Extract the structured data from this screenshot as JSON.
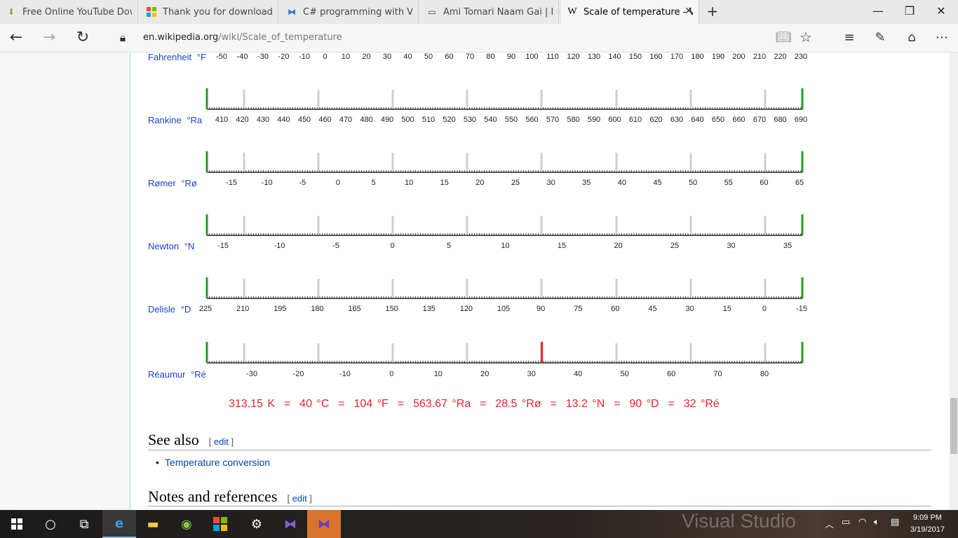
{
  "browser": {
    "tabs": [
      {
        "title": "Free Online YouTube Down",
        "icon": "download-icon",
        "active": false
      },
      {
        "title": "Thank you for downloading",
        "icon": "windows-logo-icon",
        "active": false
      },
      {
        "title": "C# programming with Visu",
        "icon": "visual-studio-icon",
        "active": false
      },
      {
        "title": "Ami Tomari Naam Gai | Bhul",
        "icon": "page-icon",
        "active": false
      },
      {
        "title": "Scale of temperature - V",
        "icon": "wikipedia-icon",
        "active": true
      }
    ],
    "url_host": "en.wikipedia.org",
    "url_path": "/wiki/Scale_of_temperature"
  },
  "scales": [
    {
      "name": "Fahrenheit",
      "unit": "°F",
      "ticks": [
        "-50",
        "-40",
        "-30",
        "-20",
        "-10",
        "0",
        "10",
        "20",
        "30",
        "40",
        "50",
        "60",
        "70",
        "80",
        "90",
        "100",
        "110",
        "120",
        "130",
        "140",
        "150",
        "160",
        "170",
        "180",
        "190",
        "200",
        "210",
        "220",
        "230"
      ]
    },
    {
      "name": "Rankine",
      "unit": "°Ra",
      "ticks": [
        "410",
        "420",
        "430",
        "440",
        "450",
        "460",
        "470",
        "480",
        "490",
        "500",
        "510",
        "520",
        "530",
        "540",
        "550",
        "560",
        "570",
        "580",
        "590",
        "600",
        "610",
        "620",
        "630",
        "640",
        "650",
        "660",
        "670",
        "680",
        "690"
      ]
    },
    {
      "name": "Rømer",
      "unit": "°Rø",
      "ticks": [
        "-15",
        "-10",
        "-5",
        "0",
        "5",
        "10",
        "15",
        "20",
        "25",
        "30",
        "35",
        "40",
        "45",
        "50",
        "55",
        "60",
        "65"
      ]
    },
    {
      "name": "Newton",
      "unit": "°N",
      "ticks": [
        "-15",
        "-10",
        "-5",
        "0",
        "5",
        "10",
        "15",
        "20",
        "25",
        "30",
        "35"
      ]
    },
    {
      "name": "Delisle",
      "unit": "°D",
      "ticks": [
        "225",
        "210",
        "195",
        "180",
        "165",
        "150",
        "135",
        "120",
        "105",
        "90",
        "75",
        "60",
        "45",
        "30",
        "15",
        "0",
        "-15"
      ]
    },
    {
      "name": "Réaumur",
      "unit": "°Ré",
      "ticks": [
        "-30",
        "-20",
        "-10",
        "0",
        "10",
        "20",
        "30",
        "40",
        "50",
        "60",
        "70",
        "80"
      ]
    }
  ],
  "readout": "313.15 K  =  40 °C  =  104 °F  =  563.67 °Ra  =  28.5 °Rø  =  13.2 °N  =  90 °D  =  32 °Ré",
  "sections": {
    "see_also_title": "See also",
    "see_also_link": "Temperature conversion",
    "notes_title": "Notes and references",
    "edit_label": "edit"
  },
  "taskbar": {
    "time": "9:09 PM",
    "date": "3/19/2017",
    "brand": "Visual Studio"
  },
  "colors": {
    "scale_label": "#1a3fd8",
    "readout": "#e8242a",
    "bound_marker": "#1aa31a",
    "current_marker": "#e8242a"
  }
}
